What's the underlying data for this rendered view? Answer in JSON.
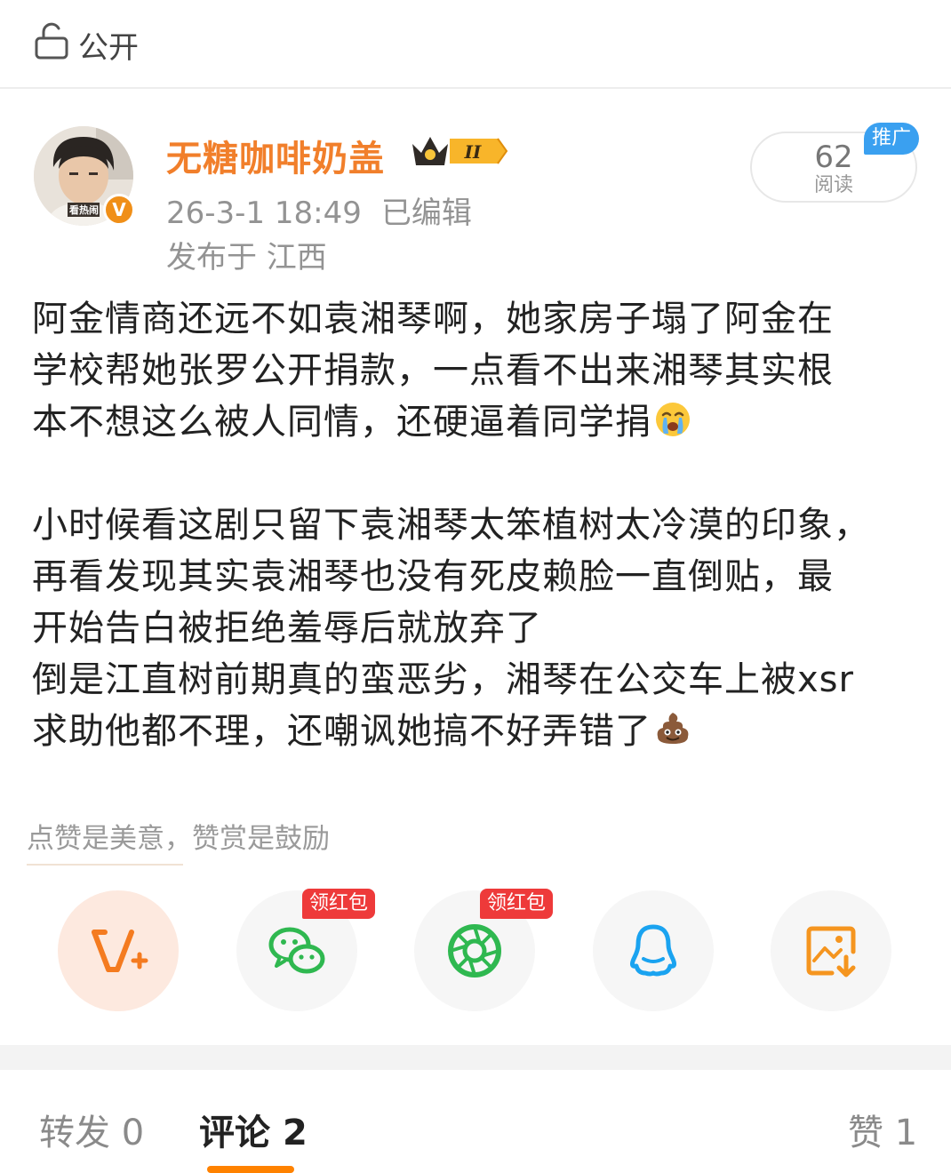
{
  "header": {
    "visibility": "公开"
  },
  "author": {
    "name": "无糖咖啡奶盖",
    "avatar_caption": "看热闹",
    "vip_level": "II"
  },
  "post": {
    "timestamp": "26-3-1 18:49",
    "edited": "已编辑",
    "location": "发布于 江西",
    "reads": {
      "count": "62",
      "label": "阅读"
    },
    "promo_tag": "推广",
    "lines": [
      "阿金情商还远不如袁湘琴啊，她家房子塌了阿金在",
      "学校帮她张罗公开捐款，一点看不出来湘琴其实根",
      "本不想这么被人同情，还硬逼着同学捐",
      "小时候看这剧只留下袁湘琴太笨植树太冷漠的印象，",
      "再看发现其实袁湘琴也没有死皮赖脸一直倒贴，最",
      "开始告白被拒绝羞辱后就放弃了",
      "倒是江直树前期真的蛮恶劣，湘琴在公交车上被xsr",
      "求助他都不理，还嘲讽她搞不好弄错了"
    ],
    "emojis": [
      "crying-face-emoji",
      "poop-emoji"
    ]
  },
  "reward": {
    "hint": "点赞是美意，赞赏是鼓励"
  },
  "share": {
    "buttons": [
      {
        "icon": "vplus-icon",
        "badge": ""
      },
      {
        "icon": "wechat-icon",
        "badge": "领红包"
      },
      {
        "icon": "moments-icon",
        "badge": "领红包"
      },
      {
        "icon": "qq-icon",
        "badge": ""
      },
      {
        "icon": "save-image-icon",
        "badge": ""
      }
    ]
  },
  "tabs": {
    "repost": {
      "label": "转发",
      "count": "0"
    },
    "comments": {
      "label": "评论",
      "count": "2"
    },
    "likes": {
      "label": "赞",
      "count": "1"
    }
  },
  "colors": {
    "brand_orange": "#ff8200",
    "username": "#f17f2b",
    "promo_blue": "#3aa0f0",
    "redpacket": "#ee3a3a"
  }
}
